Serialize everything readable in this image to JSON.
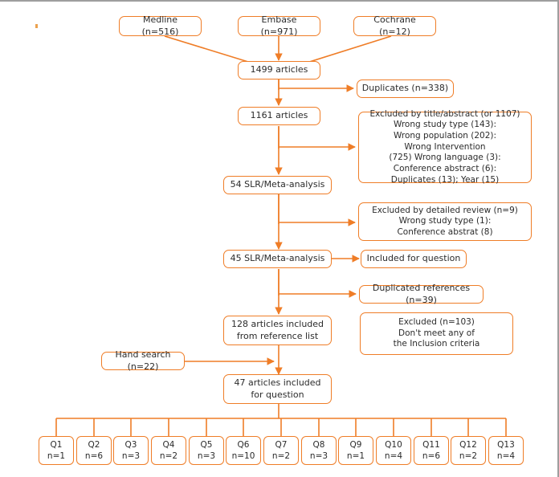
{
  "figure": {
    "type": "prisma-flow-diagram",
    "accent_color": "#ef7d27",
    "text_color": "#2b2b2b",
    "background_color": "#ffffff",
    "frame_color": "#9e9e9e"
  },
  "sources": [
    {
      "id": "medline",
      "label": "Medline (n=516)"
    },
    {
      "id": "embase",
      "label": "Embase (n=971)"
    },
    {
      "id": "cochrane",
      "label": "Cochrane (n=12)"
    }
  ],
  "flow": {
    "total_records": "1499 articles",
    "duplicates": "Duplicates (n=338)",
    "after_duplicates": "1161 articles",
    "excluded_title_abstract": "Excluded by title/abstract (or 1107)\nWrong study type (143):\nWrong population (202):\nWrong Intervention\n(725) Wrong language (3):\nConference abstract (6):\nDuplicates (13); Year (15)",
    "slr_54": "54 SLR/Meta-analysis",
    "excluded_detailed": "Excluded by detailed review (n=9)\nWrong study type (1):\nConference abstrat (8)",
    "slr_45": "45 SLR/Meta-analysis",
    "included_for_question": "Included for question",
    "duplicated_references": "Duplicated references (n=39)",
    "from_reference_list": "128 articles included\nfrom reference list",
    "excluded_inclusion": "Excluded  (n=103)\nDon't meet any of\nthe Inclusion criteria",
    "hand_search": "Hand search (n=22)",
    "final_included": "47 articles included\nfor question"
  },
  "questions": [
    {
      "id": "Q1",
      "label": "Q1\nn=1"
    },
    {
      "id": "Q2",
      "label": "Q2\nn=6"
    },
    {
      "id": "Q3",
      "label": "Q3\nn=3"
    },
    {
      "id": "Q4",
      "label": "Q4\nn=2"
    },
    {
      "id": "Q5",
      "label": "Q5\nn=3"
    },
    {
      "id": "Q6",
      "label": "Q6\nn=10"
    },
    {
      "id": "Q7",
      "label": "Q7\nn=2"
    },
    {
      "id": "Q8",
      "label": "Q8\nn=3"
    },
    {
      "id": "Q9",
      "label": "Q9\nn=1"
    },
    {
      "id": "Q10",
      "label": "Q10\nn=4"
    },
    {
      "id": "Q11",
      "label": "Q11\nn=6"
    },
    {
      "id": "Q12",
      "label": "Q12\nn=2"
    },
    {
      "id": "Q13",
      "label": "Q13\nn=4"
    }
  ]
}
